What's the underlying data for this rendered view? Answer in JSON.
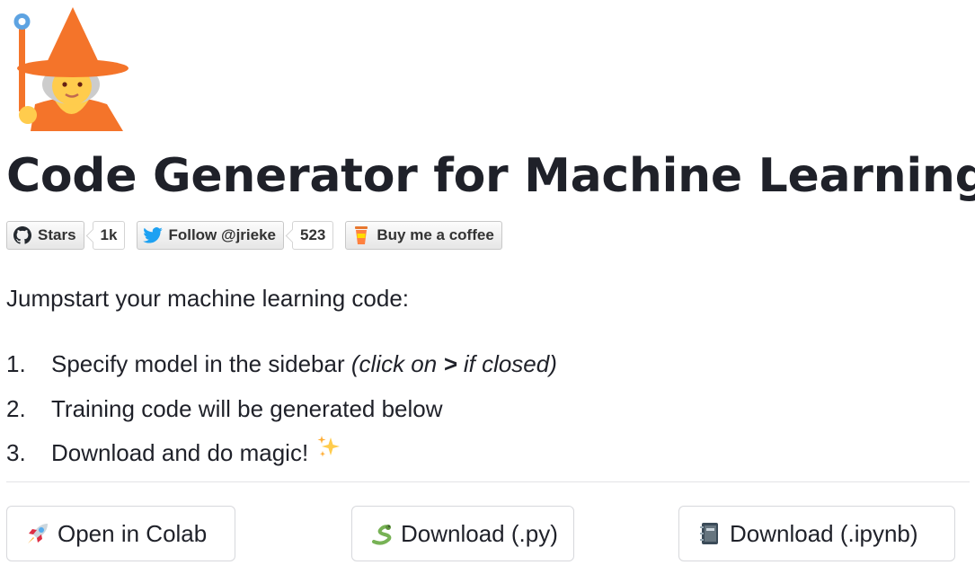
{
  "header": {
    "logo_icon": "wizard-emoji-icon",
    "title": "Code Generator for Machine Learning"
  },
  "badges": {
    "github": {
      "icon": "github-icon",
      "label": "Stars",
      "count": "1k"
    },
    "twitter": {
      "icon": "twitter-bird-icon",
      "label": "Follow @jrieke",
      "count": "523"
    },
    "coffee": {
      "icon": "coffee-cup-icon",
      "label": "Buy me a coffee"
    }
  },
  "intro": "Jumpstart your machine learning code:",
  "steps": [
    {
      "num": "1.",
      "text": "Specify model in the sidebar ",
      "hint_pre": "(click on ",
      "hint_key": ">",
      "hint_post": " if closed)"
    },
    {
      "num": "2.",
      "text": "Training code will be generated below"
    },
    {
      "num": "3.",
      "text": "Download and do magic!",
      "icon": "sparkles-icon"
    }
  ],
  "actions": [
    {
      "icon": "rocket-icon",
      "label": "Open in Colab"
    },
    {
      "icon": "snake-icon",
      "label": "Download (.py)"
    },
    {
      "icon": "notebook-icon",
      "label": "Download (.ipynb)"
    }
  ],
  "colors": {
    "text": "#1f2129",
    "wizard_hat": "#f4742a",
    "twitter_blue": "#1da1f2",
    "border": "#d7d8dc"
  }
}
